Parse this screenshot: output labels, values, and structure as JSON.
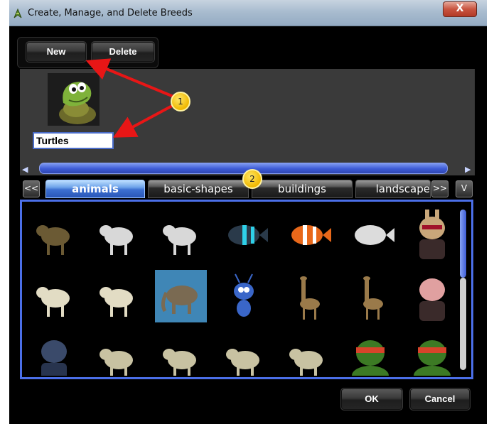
{
  "window": {
    "title": "Create, Manage, and Delete Breeds",
    "close_label": "X"
  },
  "toolbar": {
    "new_label": "New",
    "delete_label": "Delete"
  },
  "breed": {
    "name_value": "Turtles"
  },
  "nav": {
    "prev_label": "<<",
    "next_label": ">>",
    "expand_label": "V"
  },
  "tabs": [
    {
      "label": "animals",
      "active": true
    },
    {
      "label": "basic-shapes",
      "active": false
    },
    {
      "label": "buildings",
      "active": false
    },
    {
      "label": "landscape",
      "active": false
    }
  ],
  "grid": {
    "rows": [
      [
        "bear",
        "polar-bear",
        "polar-bear",
        "striped-fish",
        "clownfish",
        "white-fish",
        "bunny-suit-character"
      ],
      [
        "dog",
        "dog",
        "elephant",
        "cartoon-ant",
        "giraffe",
        "giraffe",
        "pig-creature"
      ],
      [
        "penguin-diver",
        "wolf",
        "wolf",
        "wolf",
        "wolf",
        "ninja-turtle",
        "ninja-turtle"
      ]
    ],
    "selected": "elephant"
  },
  "markers": [
    {
      "label": "1"
    },
    {
      "label": "2"
    }
  ],
  "footer": {
    "ok_label": "OK",
    "cancel_label": "Cancel"
  },
  "colors": {
    "accent": "#4b6fe8",
    "arrow": "#e81616",
    "marker": "#f0b800"
  }
}
